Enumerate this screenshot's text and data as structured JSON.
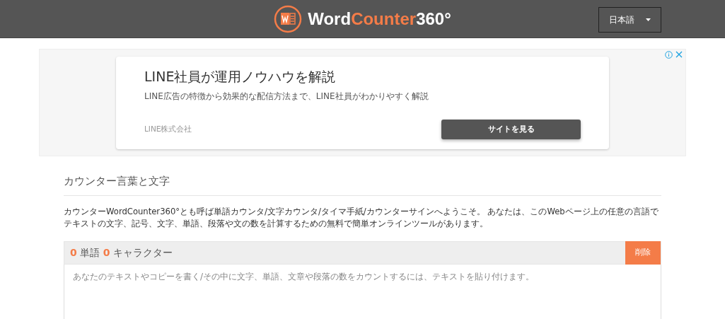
{
  "header": {
    "logo": {
      "parts": [
        "Word",
        "Counter",
        "360°"
      ]
    },
    "language": "日本語"
  },
  "ad": {
    "title": "LINE社員が運用ノウハウを解説",
    "description": "LINE広告の特徴から効果的な配信方法まで、LINE社員がわかりやすく解説",
    "advertiser": "LINE株式会社",
    "button": "サイトを見る"
  },
  "section": {
    "title": "カウンター言葉と文字",
    "intro": "カウンターWordCounter360°とも呼ば単語カウンタ/文字カウンタ/タイマ手紙/カウンターサインへようこそ。 あなたは、このWebページ上の任意の言語でテキストの文字、記号、文字、単語、段落や文の数を計算するための無料で簡単オンラインツールがあります。"
  },
  "counter": {
    "words": "0",
    "words_label": "単語",
    "characters": "0",
    "characters_label": "キャラクター",
    "clear_button": "削除",
    "placeholder": "あなたのテキストやコピーを書く/その中に文字、単語、文章や段落の数をカウントするには、テキストを貼り付けます。"
  }
}
